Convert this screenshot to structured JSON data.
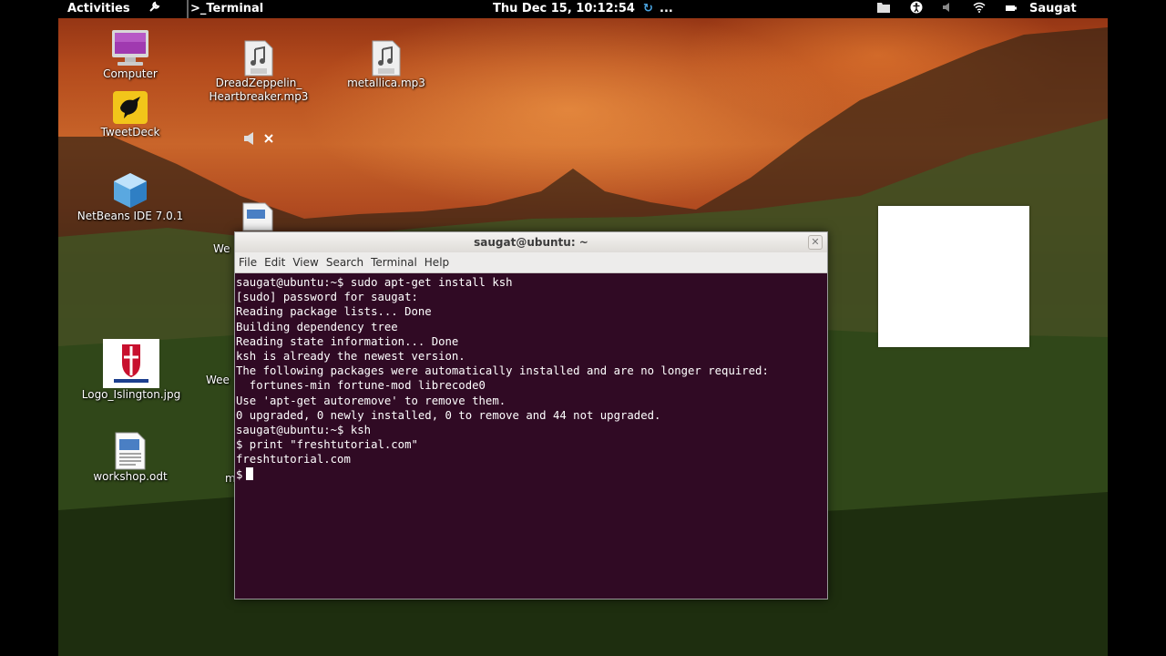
{
  "panel": {
    "activities": "Activities",
    "app_menu": "Terminal",
    "clock": "Thu Dec 15, 10:12:54",
    "more": "...",
    "user": "Saugat"
  },
  "desktop": {
    "icons": [
      {
        "label": "Computer"
      },
      {
        "label": "TweetDeck"
      },
      {
        "label": "NetBeans IDE 7.0.1"
      },
      {
        "label": "Logo_Islington.jpg"
      },
      {
        "label": "workshop.odt"
      },
      {
        "label": "DreadZeppelin_\nHeartbreaker.mp3"
      },
      {
        "label": "metallica.mp3"
      }
    ],
    "partial_labels": [
      "We",
      "Wee",
      "m"
    ]
  },
  "terminal": {
    "title": "saugat@ubuntu: ~",
    "menu": [
      "File",
      "Edit",
      "View",
      "Search",
      "Terminal",
      "Help"
    ],
    "lines": [
      "saugat@ubuntu:~$ sudo apt-get install ksh",
      "[sudo] password for saugat:",
      "Reading package lists... Done",
      "Building dependency tree",
      "Reading state information... Done",
      "ksh is already the newest version.",
      "The following packages were automatically installed and are no longer required:",
      "  fortunes-min fortune-mod librecode0",
      "Use 'apt-get autoremove' to remove them.",
      "0 upgraded, 0 newly installed, 0 to remove and 44 not upgraded.",
      "saugat@ubuntu:~$ ksh",
      "$ print \"freshtutorial.com\"",
      "freshtutorial.com"
    ],
    "prompt": "$"
  },
  "colors": {
    "terminal_bg": "#300a24",
    "panel_bg": "#000000",
    "accent": "#4aa3df"
  }
}
